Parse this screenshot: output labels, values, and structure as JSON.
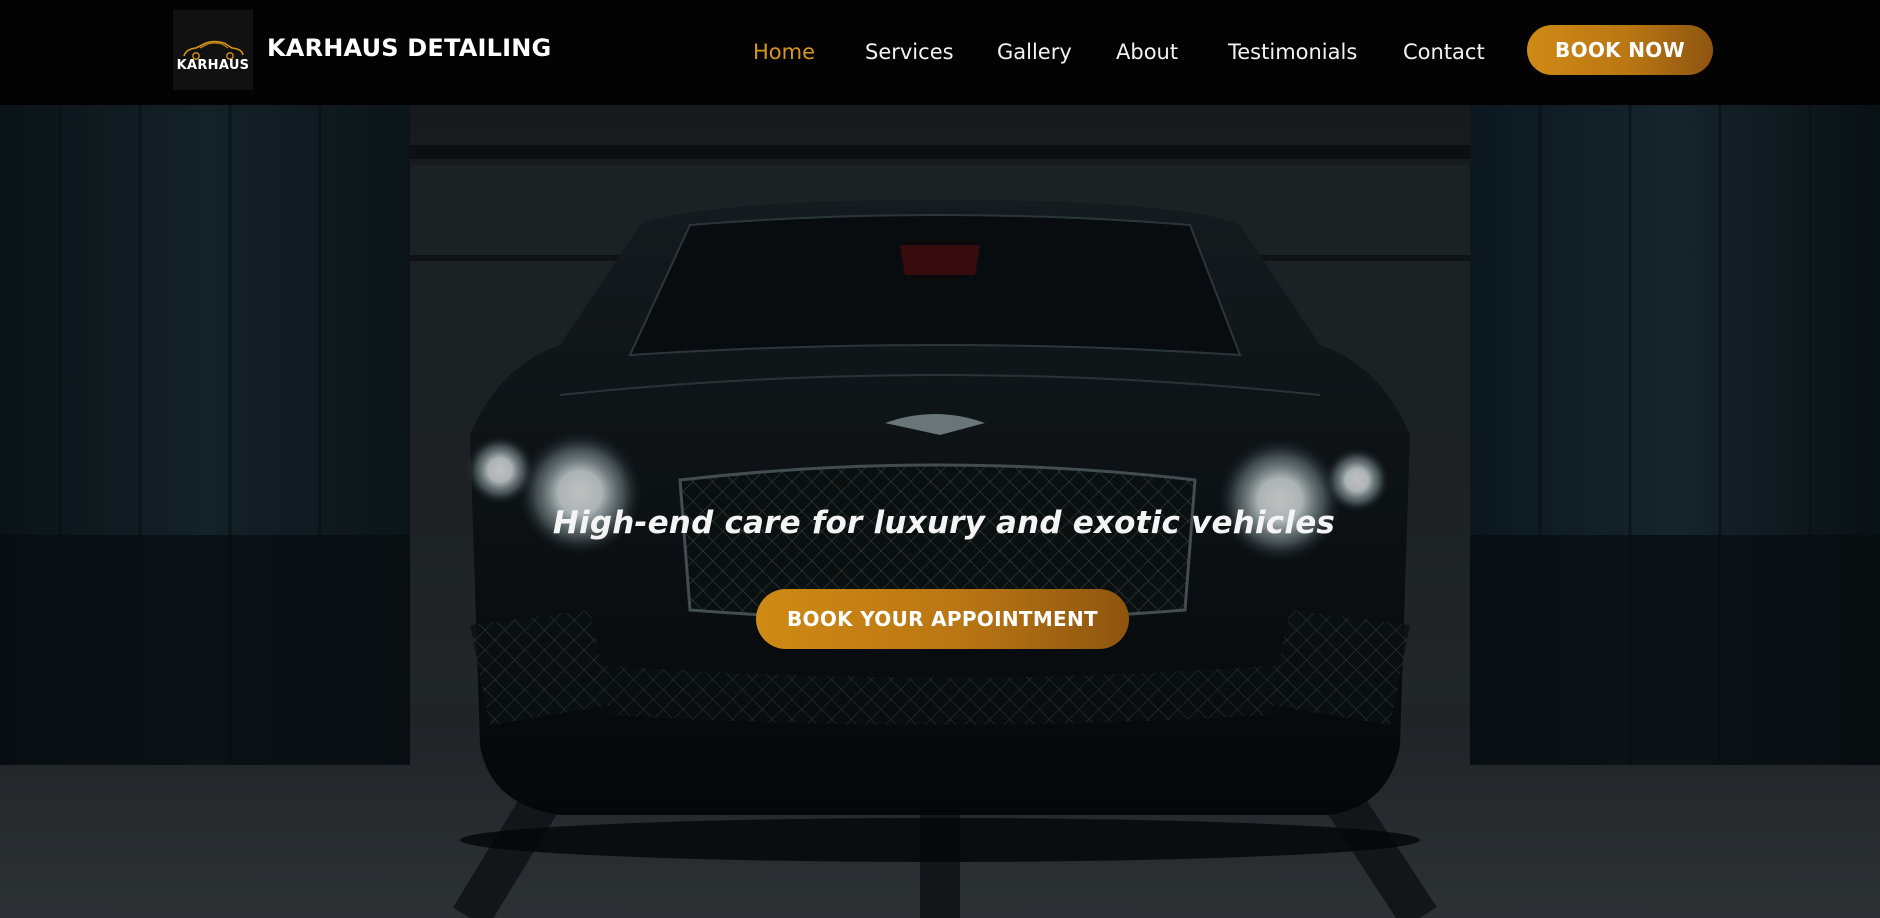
{
  "header": {
    "logo_text": "KARHAUS",
    "brand_name": "KARHAUS DETAILING",
    "nav": [
      {
        "label": "Home",
        "active": true
      },
      {
        "label": "Services",
        "active": false
      },
      {
        "label": "Gallery",
        "active": false
      },
      {
        "label": "About",
        "active": false
      },
      {
        "label": "Testimonials",
        "active": false
      },
      {
        "label": "Contact",
        "active": false
      }
    ],
    "book_now_label": "BOOK NOW"
  },
  "hero": {
    "tagline": "High-end care for luxury and exotic vehicles",
    "cta_label": "BOOK YOUR APPOINTMENT",
    "background_image": "dark-luxury-car-in-detailing-garage"
  },
  "colors": {
    "accent": "#d8961a",
    "button_gradient_start": "#cf8a14",
    "button_gradient_end": "#8e5510",
    "header_bg": "#030303"
  }
}
